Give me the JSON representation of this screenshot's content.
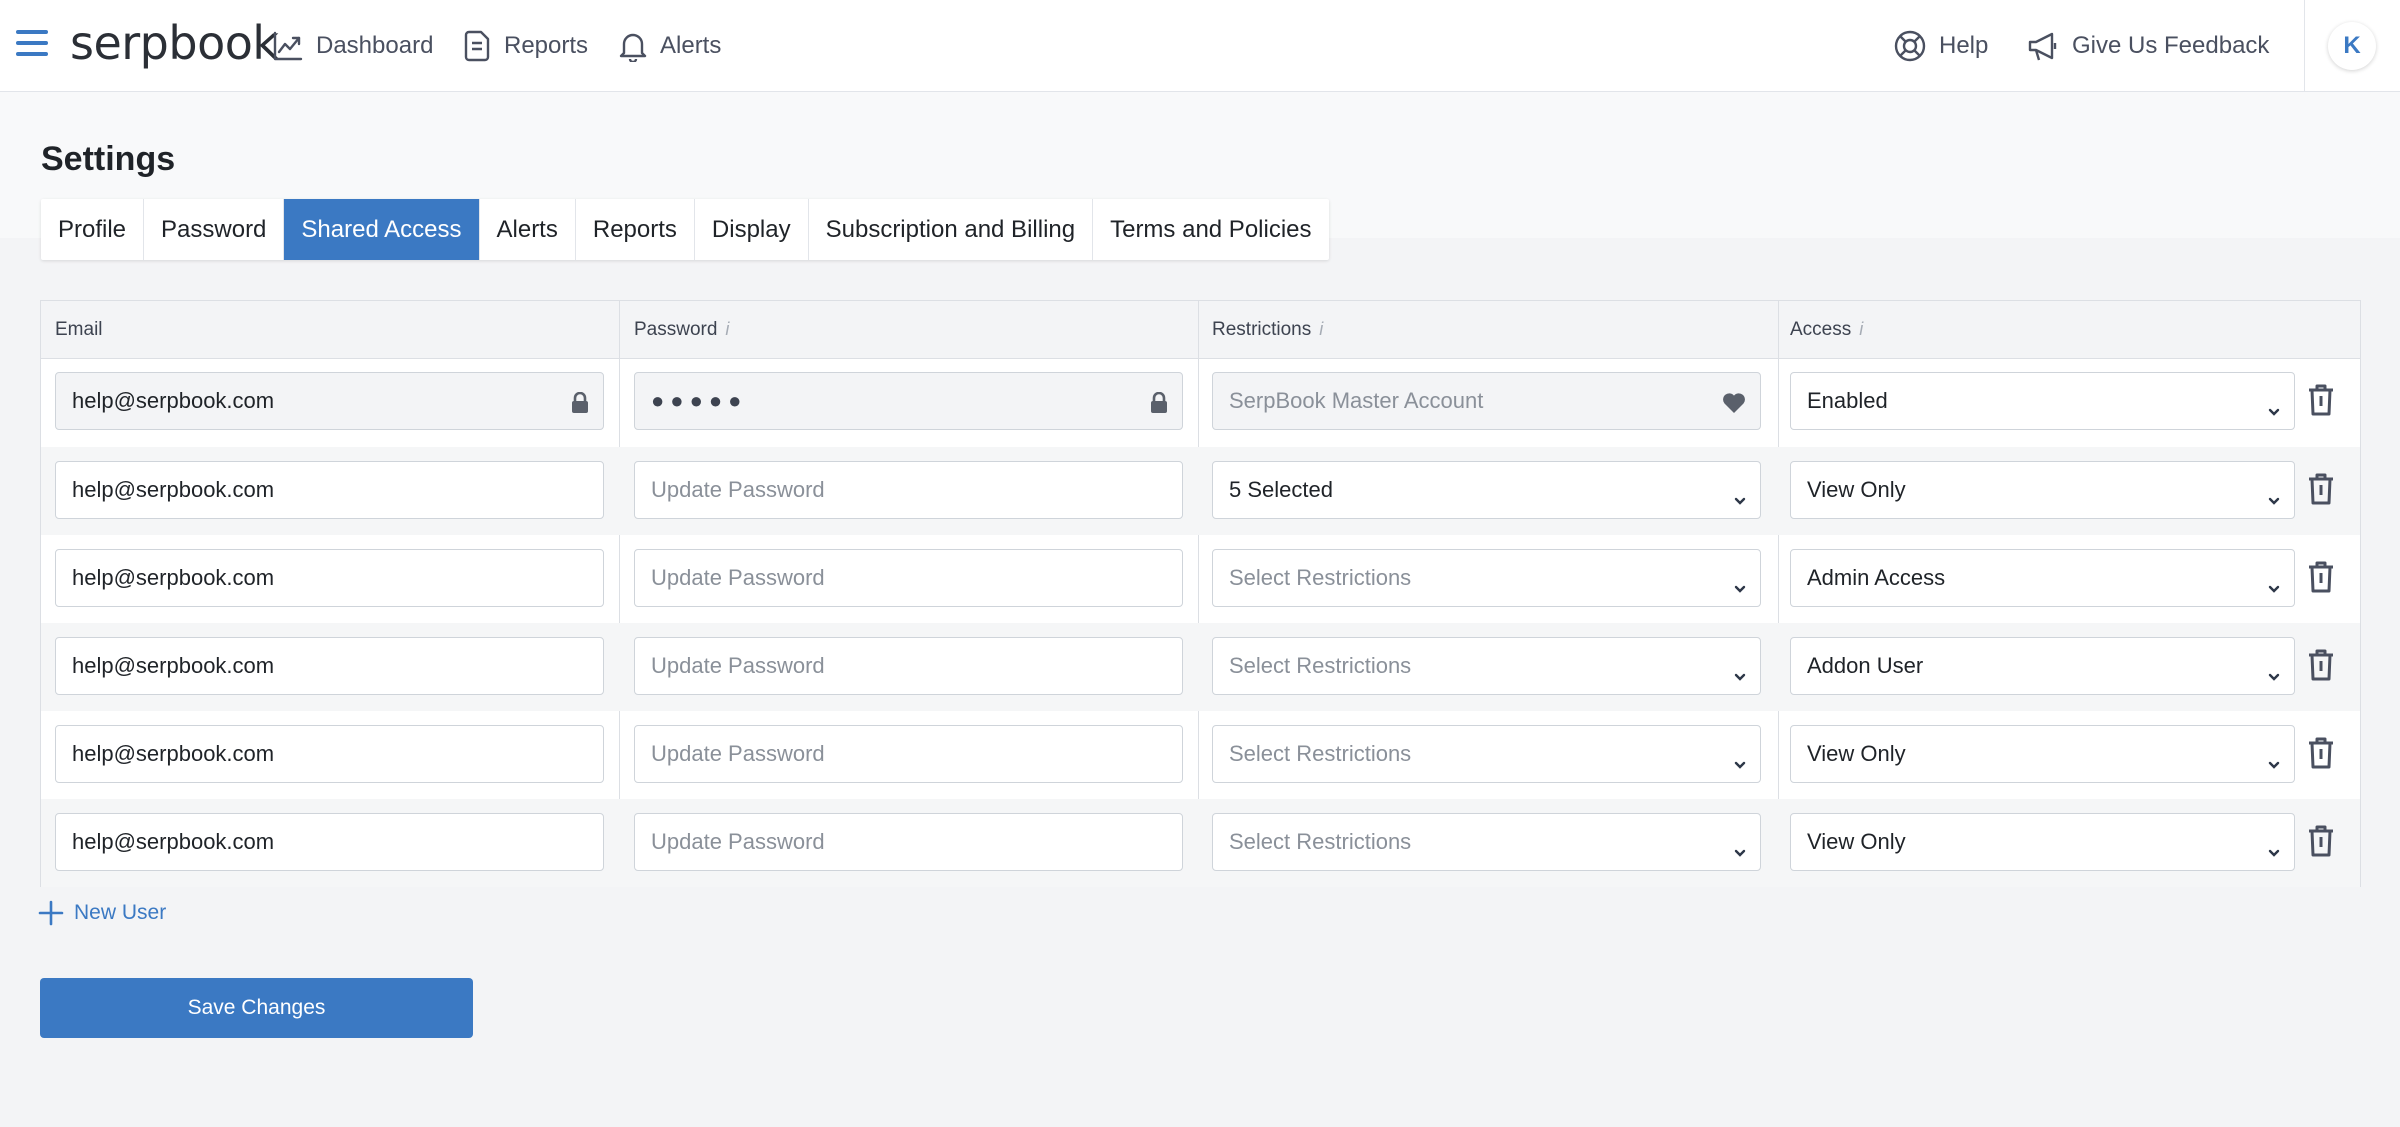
{
  "nav": {
    "logo": "serpbook",
    "items": [
      {
        "label": "Dashboard",
        "icon": "chart-line-icon"
      },
      {
        "label": "Reports",
        "icon": "document-icon"
      },
      {
        "label": "Alerts",
        "icon": "bell-icon"
      }
    ],
    "help_label": "Help",
    "feedback_label": "Give Us Feedback",
    "avatar_initial": "K"
  },
  "page": {
    "title": "Settings",
    "tabs": [
      "Profile",
      "Password",
      "Shared Access",
      "Alerts",
      "Reports",
      "Display",
      "Subscription and Billing",
      "Terms and Policies"
    ],
    "active_tab": "Shared Access"
  },
  "table": {
    "headers": {
      "email": "Email",
      "password": "Password",
      "restrictions": "Restrictions",
      "access": "Access",
      "info_glyph": "i"
    },
    "rows": [
      {
        "email": "help@serpbook.com",
        "password": "●●●●●",
        "restrictions": "SerpBook Master Account",
        "access": "Enabled",
        "locked": true
      },
      {
        "email": "help@serpbook.com",
        "password": "Update Password",
        "restrictions": "5 Selected",
        "access": "View Only",
        "locked": false
      },
      {
        "email": "help@serpbook.com",
        "password": "Update Password",
        "restrictions": "Select Restrictions",
        "access": "Admin Access",
        "locked": false
      },
      {
        "email": "help@serpbook.com",
        "password": "Update Password",
        "restrictions": "Select Restrictions",
        "access": "Addon User",
        "locked": false
      },
      {
        "email": "help@serpbook.com",
        "password": "Update Password",
        "restrictions": "Select Restrictions",
        "access": "View Only",
        "locked": false
      },
      {
        "email": "help@serpbook.com",
        "password": "Update Password",
        "restrictions": "Select Restrictions",
        "access": "View Only",
        "locked": false
      }
    ]
  },
  "actions": {
    "new_user_label": "New User",
    "save_label": "Save Changes"
  },
  "colors": {
    "accent": "#3b79c3",
    "background": "#f3f4f6"
  }
}
